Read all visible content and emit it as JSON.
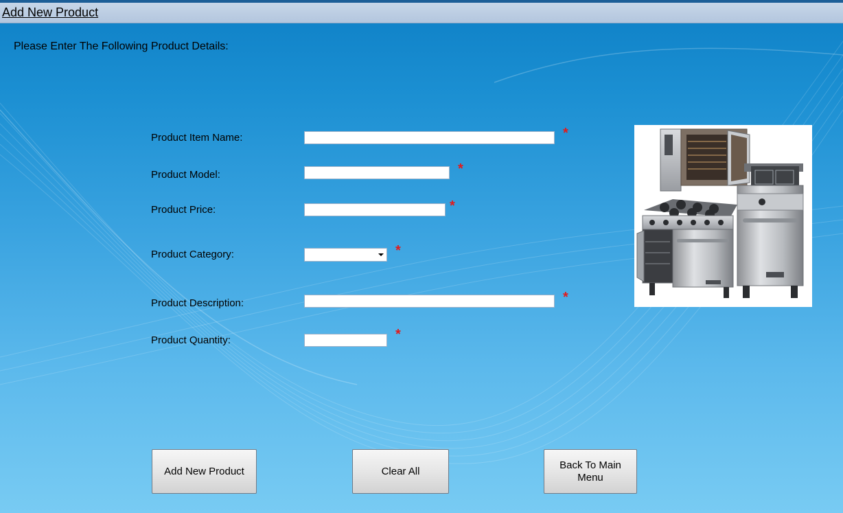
{
  "window": {
    "title": "Add New Product"
  },
  "form": {
    "instruction": "Please Enter The Following Product Details:",
    "required_marker": "*",
    "fields": {
      "item_name": {
        "label": "Product Item Name:",
        "value": ""
      },
      "model": {
        "label": "Product Model:",
        "value": ""
      },
      "price": {
        "label": "Product Price:",
        "value": ""
      },
      "category": {
        "label": "Product Category:",
        "selected": ""
      },
      "description": {
        "label": "Product Description:",
        "value": ""
      },
      "quantity": {
        "label": "Product Quantity:",
        "value": ""
      }
    }
  },
  "buttons": {
    "add": "Add New Product",
    "clear": "Clear All",
    "back": "Back To Main Menu"
  },
  "icons": {
    "category_dropdown": "chevron-down-icon",
    "product_image": "commercial-kitchen-equipment-image"
  },
  "colors": {
    "required": "#e21b1b",
    "titlebar": "#b9cbe0",
    "background": "#1b8fd2"
  }
}
